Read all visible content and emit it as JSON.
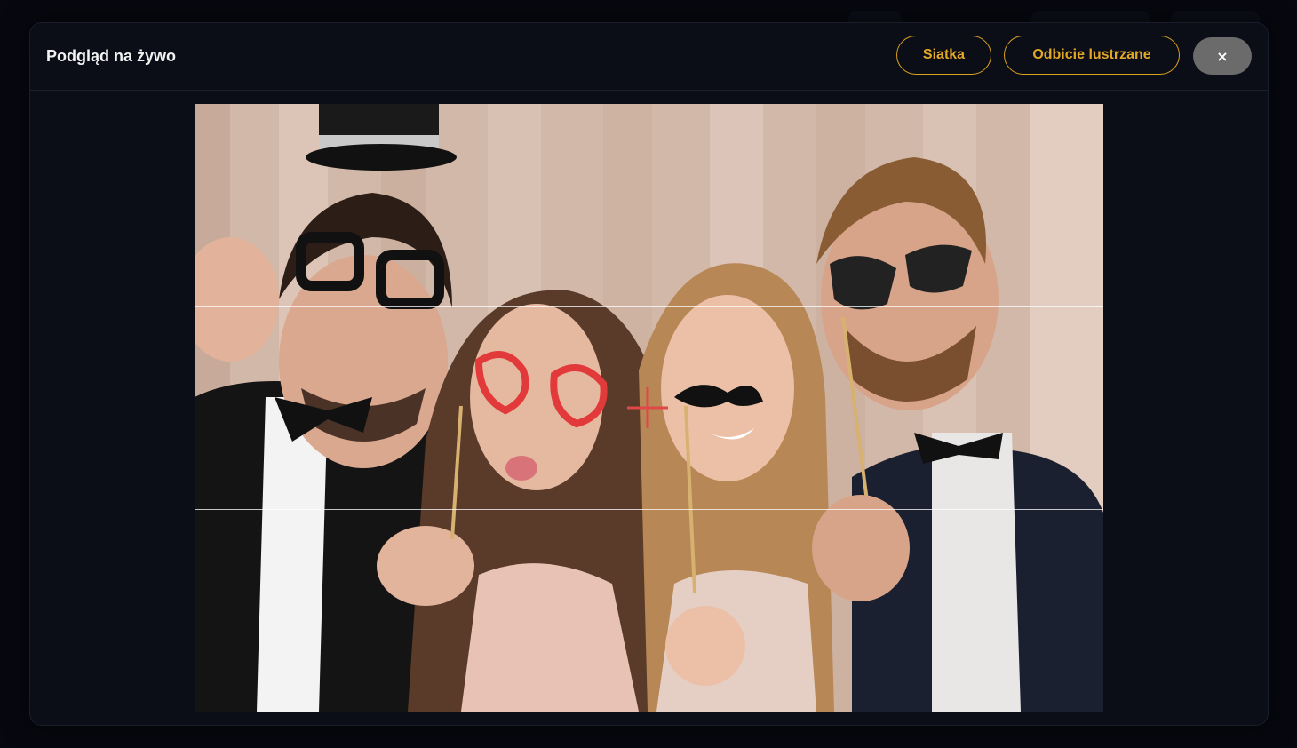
{
  "modal": {
    "title": "Podgląd na żywo",
    "grid_button_label": "Siatka",
    "mirror_button_label": "Odbicie lustrzane",
    "close_button_label": "×"
  },
  "preview": {
    "grid_visible": true,
    "crosshair_color": "#e04848",
    "description_icon": "camera-live-preview"
  },
  "colors": {
    "accent": "#e3a826",
    "background": "#0b0d17",
    "close_button": "#6b6b6b"
  }
}
